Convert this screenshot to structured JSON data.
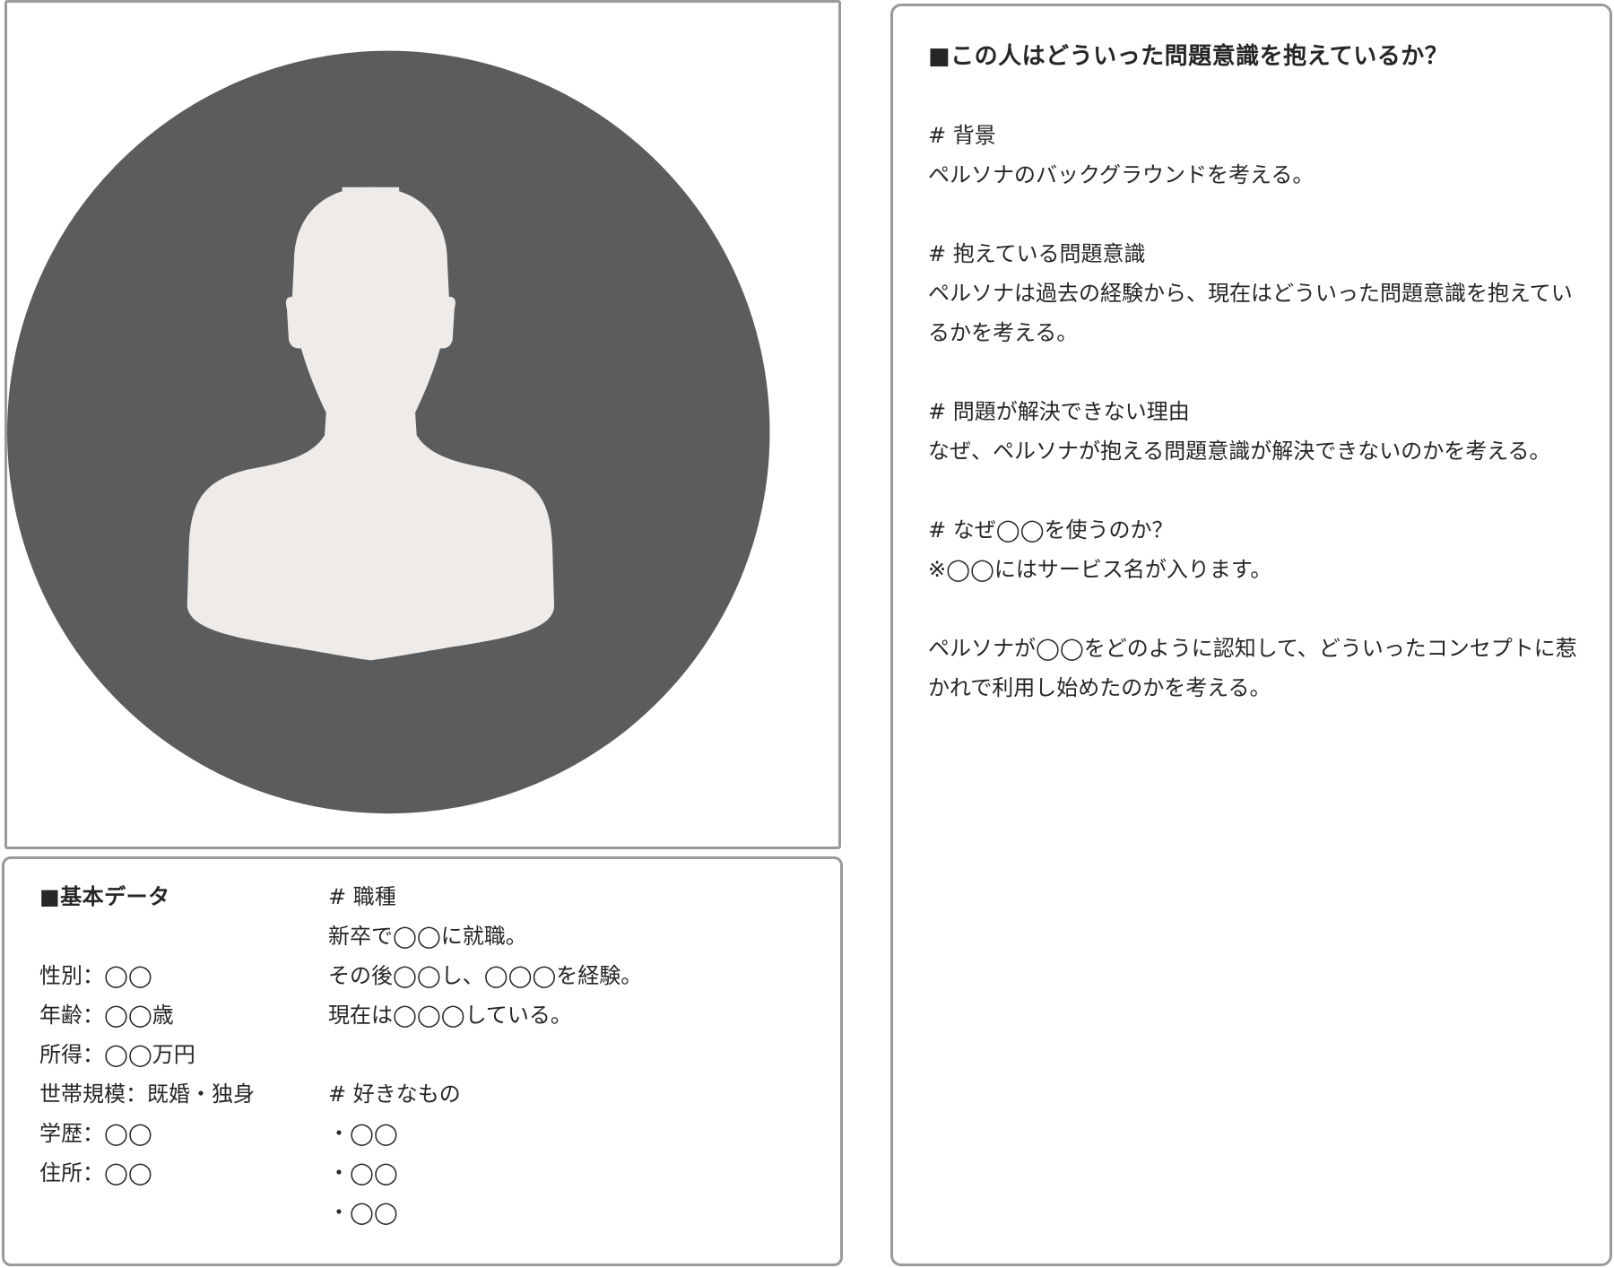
{
  "basic": {
    "title": "■基本データ",
    "fields": [
      "性別：◯◯",
      "年齢：◯◯歳",
      "所得：◯◯万円",
      "世帯規模：既婚・独身",
      "学歴：◯◯",
      "住所：◯◯"
    ],
    "job": {
      "heading": "# 職種",
      "lines": [
        "新卒で◯◯に就職。",
        "その後◯◯し、◯◯◯を経験。",
        "現在は◯◯◯している。"
      ]
    },
    "likes": {
      "heading": "# 好きなもの",
      "items": [
        "・◯◯",
        "・◯◯",
        "・◯◯"
      ]
    }
  },
  "problem": {
    "title": "■この人はどういった問題意識を抱えているか？",
    "sections": [
      {
        "heading": "# 背景",
        "text": "ペルソナのバックグラウンドを考える。"
      },
      {
        "heading": "# 抱えている問題意識",
        "text": "ペルソナは過去の経験から、現在はどういった問題意識を抱えているかを考える。"
      },
      {
        "heading": "# 問題が解決できない理由",
        "text": "なぜ、ペルソナが抱える問題意識が解決できないのかを考える。"
      },
      {
        "heading": "# なぜ◯◯を使うのか？",
        "text": "※◯◯にはサービス名が入ります。"
      }
    ],
    "closing": "ペルソナが◯◯をどのように認知して、どういったコンセプトに惹かれで利用し始めたのかを考える。"
  },
  "colors": {
    "avatar_bg": "#5b5c5e",
    "silhouette": "#eeebe8",
    "border": "#9a9a9a"
  },
  "icons": {
    "avatar": "person-silhouette-icon"
  }
}
